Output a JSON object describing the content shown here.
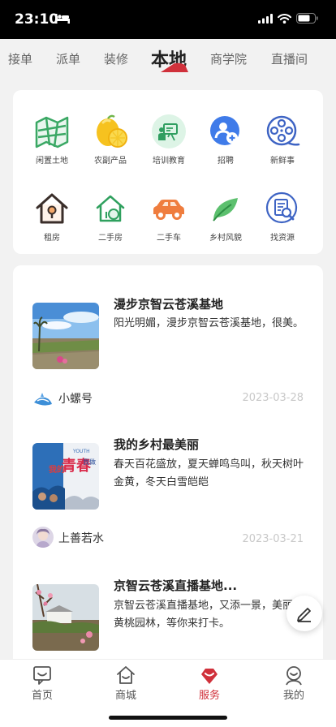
{
  "status_bar": {
    "time": "23:10"
  },
  "tabs": [
    {
      "label": "接单"
    },
    {
      "label": "派单"
    },
    {
      "label": "装修"
    },
    {
      "label": "本地",
      "active": true
    },
    {
      "label": "商学院"
    },
    {
      "label": "直播间"
    }
  ],
  "accent_color": "#d0313b",
  "categories": [
    {
      "label": "闲置土地",
      "icon": "land-map-icon"
    },
    {
      "label": "农副产品",
      "icon": "lemon-icon"
    },
    {
      "label": "培训教育",
      "icon": "training-board-icon"
    },
    {
      "label": "招聘",
      "icon": "add-user-icon"
    },
    {
      "label": "新鲜事",
      "icon": "film-reel-icon"
    },
    {
      "label": "租房",
      "icon": "house-lock-icon"
    },
    {
      "label": "二手房",
      "icon": "house-icon"
    },
    {
      "label": "二手车",
      "icon": "car-icon"
    },
    {
      "label": "乡村风貌",
      "icon": "leaf-icon"
    },
    {
      "label": "找资源",
      "icon": "document-search-icon"
    }
  ],
  "posts": [
    {
      "title": "漫步京智云苍溪基地",
      "desc": "阳光明媚，漫步京智云苍溪基地，很美。",
      "author": "小螺号",
      "date": "2023-03-28"
    },
    {
      "title": "我的乡村最美丽",
      "desc": "春天百花盛放，夏天蝉鸣鸟叫，秋天树叶金黄，冬天白雪皑皑",
      "author": "上善若水",
      "date": "2023-03-21",
      "thumb_text_1": "YOUTH",
      "thumb_text_2": "我的",
      "thumb_text_3": "青春",
      "thumb_text_4": "我做"
    },
    {
      "title": "京智云苍溪直播基地...",
      "desc": "京智云苍溪直播基地，又添一景，美丽的黄桃园林，等你来打卡。"
    }
  ],
  "fab": {
    "icon": "edit-pencil-icon"
  },
  "bottom_nav": [
    {
      "label": "首页",
      "icon": "home-chat-icon"
    },
    {
      "label": "商城",
      "icon": "shop-house-icon"
    },
    {
      "label": "服务",
      "icon": "service-heart-icon",
      "active": true
    },
    {
      "label": "我的",
      "icon": "profile-smile-icon"
    }
  ]
}
